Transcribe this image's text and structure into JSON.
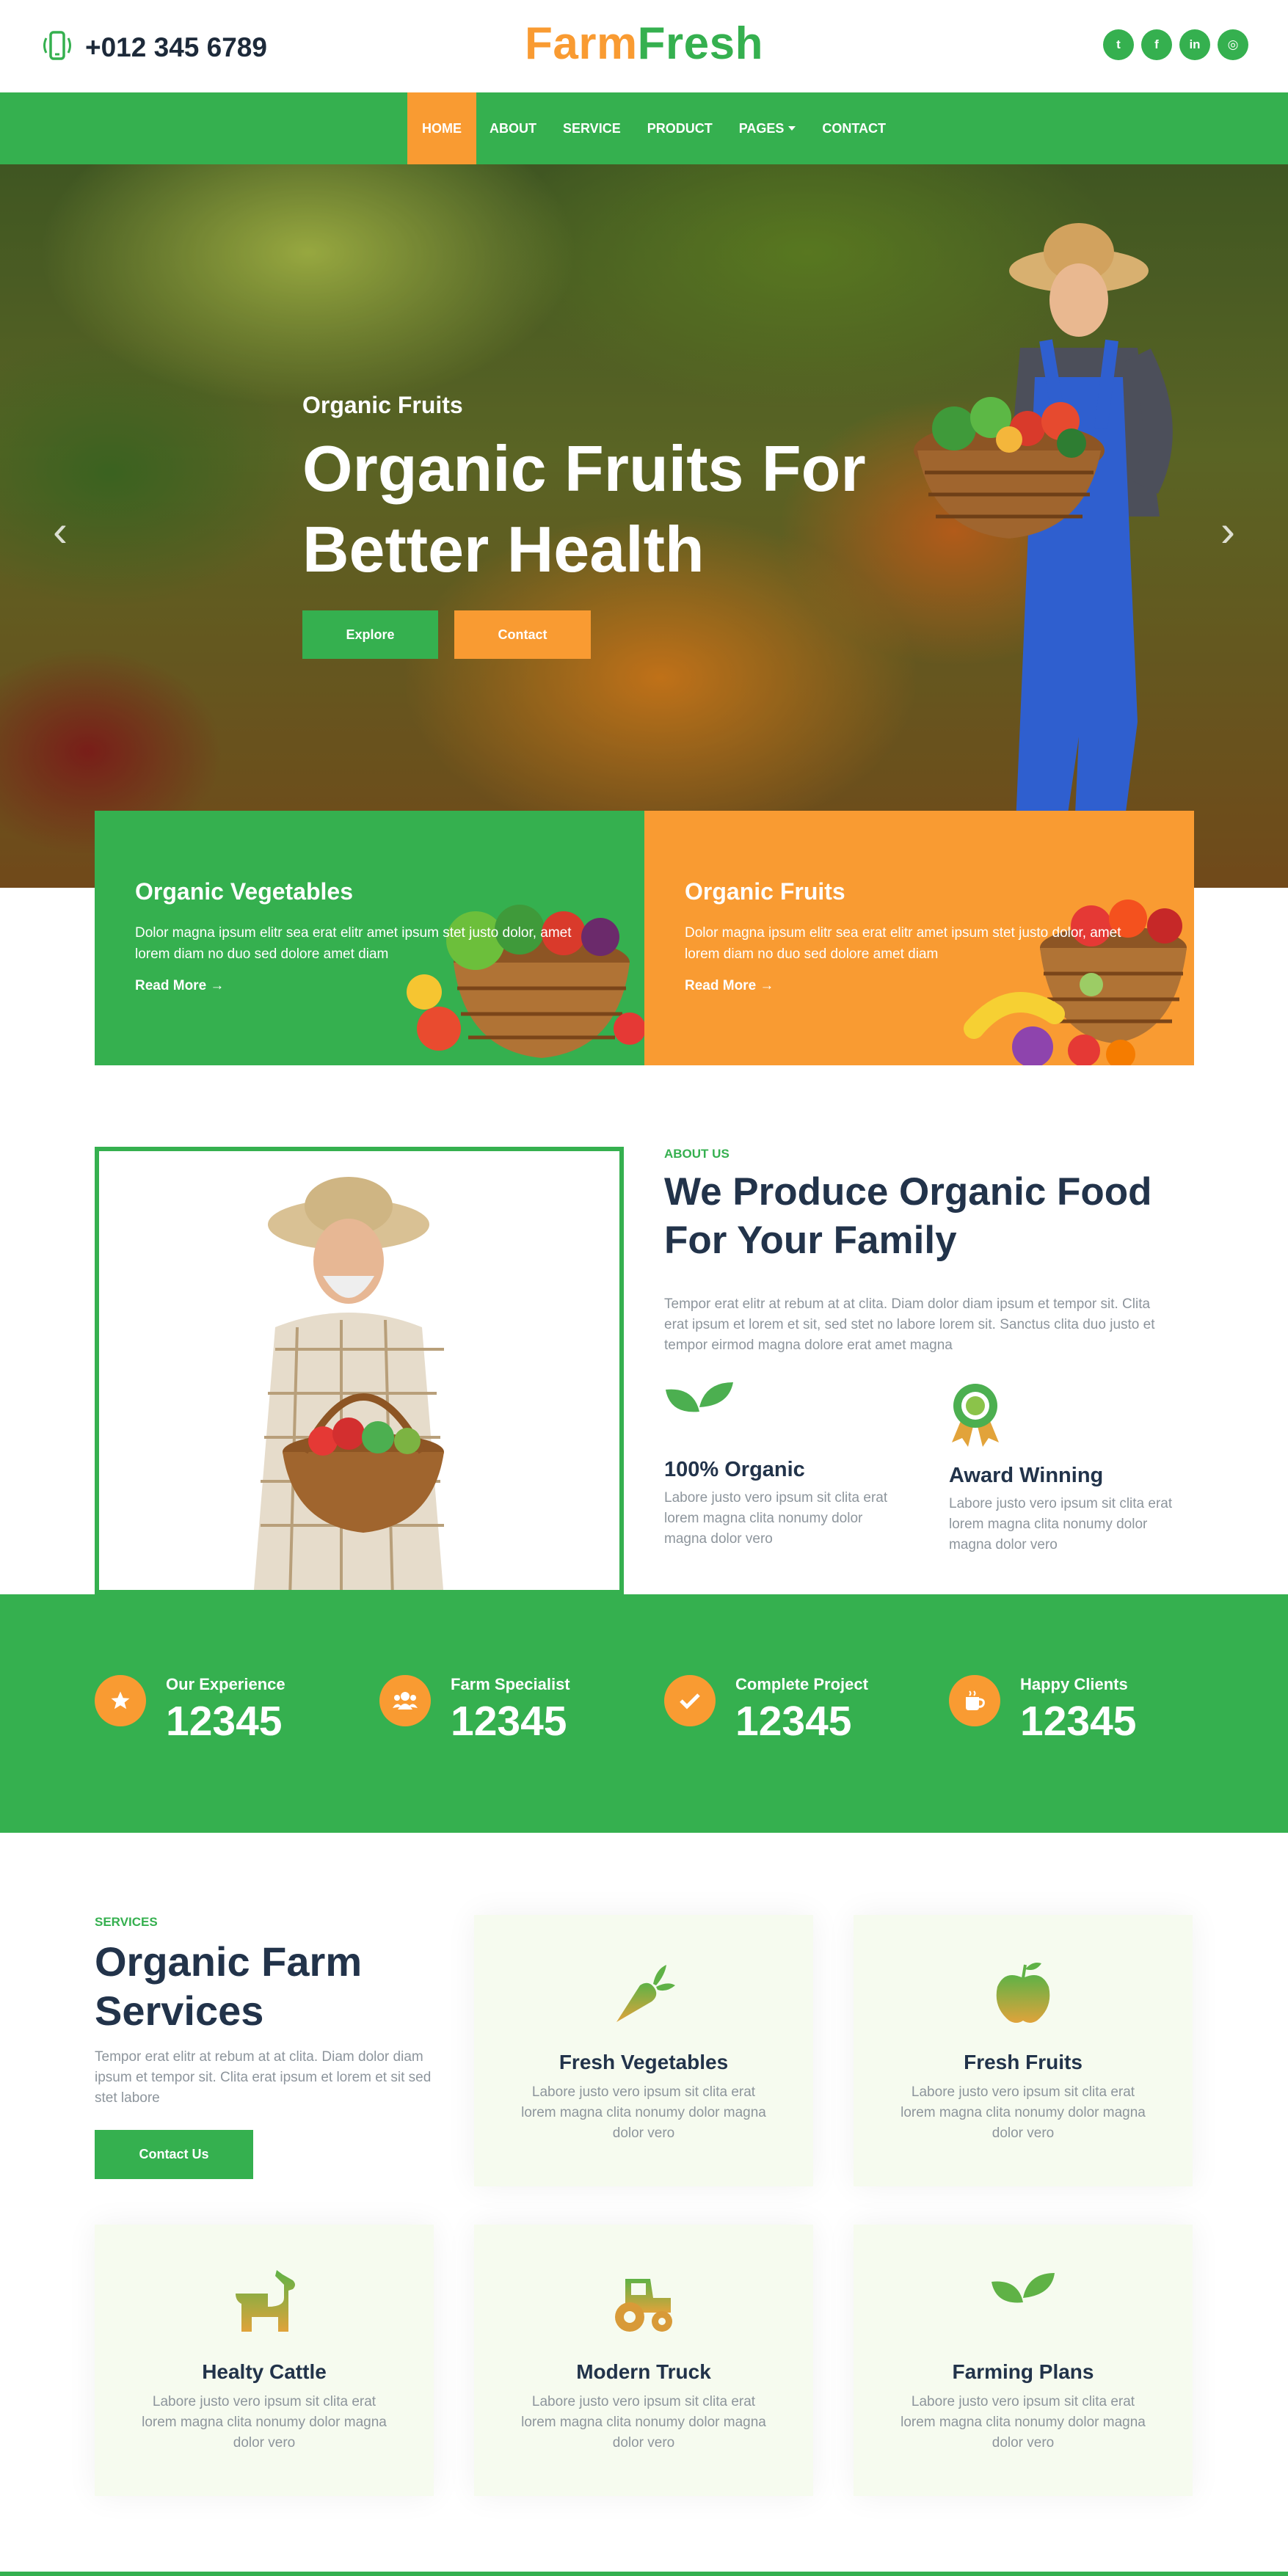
{
  "topbar": {
    "phone": "+012 345 6789",
    "logo_part1": "Farm",
    "logo_part2": "Fresh",
    "socials": [
      {
        "icon": "twitter-icon",
        "glyph": "t"
      },
      {
        "icon": "facebook-icon",
        "glyph": "f"
      },
      {
        "icon": "linkedin-icon",
        "glyph": "in"
      },
      {
        "icon": "instagram-icon",
        "glyph": "◎"
      }
    ]
  },
  "nav": {
    "items": [
      {
        "label": "HOME",
        "active": true
      },
      {
        "label": "ABOUT"
      },
      {
        "label": "SERVICE"
      },
      {
        "label": "PRODUCT"
      },
      {
        "label": "PAGES",
        "dropdown": true
      },
      {
        "label": "CONTACT"
      }
    ]
  },
  "hero": {
    "subtitle": "Organic Fruits",
    "title": "Organic Fruits For Better Health",
    "explore_label": "Explore",
    "contact_label": "Contact",
    "prev_arrow": "‹",
    "next_arrow": "›"
  },
  "promos": [
    {
      "title": "Organic Vegetables",
      "text": "Dolor magna ipsum elitr sea erat elitr amet ipsum stet justo dolor, amet lorem diam no duo sed dolore amet diam",
      "link": "Read More →"
    },
    {
      "title": "Organic Fruits",
      "text": "Dolor magna ipsum elitr sea erat elitr amet ipsum stet justo dolor, amet lorem diam no duo sed dolore amet diam",
      "link": "Read More →"
    }
  ],
  "about": {
    "label": "ABOUT US",
    "title": "We Produce Organic Food For Your Family",
    "text": "Tempor erat elitr at rebum at at clita. Diam dolor diam ipsum et tempor sit. Clita erat ipsum et lorem et sit, sed stet no labore lorem sit. Sanctus clita duo justo et tempor eirmod magna dolore erat amet magna",
    "features": [
      {
        "title": "100% Organic",
        "text": "Labore justo vero ipsum sit clita erat lorem magna clita nonumy dolor magna dolor vero",
        "icon": "sprout-icon"
      },
      {
        "title": "Award Winning",
        "text": "Labore justo vero ipsum sit clita erat lorem magna clita nonumy dolor magna dolor vero",
        "icon": "award-icon"
      }
    ]
  },
  "stats": [
    {
      "label": "Our Experience",
      "value": "12345",
      "icon": "star-icon"
    },
    {
      "label": "Farm Specialist",
      "value": "12345",
      "icon": "users-icon"
    },
    {
      "label": "Complete Project",
      "value": "12345",
      "icon": "check-icon"
    },
    {
      "label": "Happy Clients",
      "value": "12345",
      "icon": "mug-icon"
    }
  ],
  "services": {
    "label": "SERVICES",
    "title": "Organic Farm Services",
    "text": "Tempor erat elitr at rebum at at clita. Diam dolor diam ipsum et tempor sit. Clita erat ipsum et lorem et sit sed stet labore",
    "button_label": "Contact Us",
    "cards": [
      {
        "title": "Fresh Vegetables",
        "text": "Labore justo vero ipsum sit clita erat lorem magna clita nonumy dolor magna dolor vero",
        "icon": "carrot-icon"
      },
      {
        "title": "Fresh Fruits",
        "text": "Labore justo vero ipsum sit clita erat lorem magna clita nonumy dolor magna dolor vero",
        "icon": "apple-icon"
      },
      {
        "title": "Healty Cattle",
        "text": "Labore justo vero ipsum sit clita erat lorem magna clita nonumy dolor magna dolor vero",
        "icon": "dog-icon"
      },
      {
        "title": "Modern Truck",
        "text": "Labore justo vero ipsum sit clita erat lorem magna clita nonumy dolor magna dolor vero",
        "icon": "tractor-icon"
      },
      {
        "title": "Farming Plans",
        "text": "Labore justo vero ipsum sit clita erat lorem magna clita nonumy dolor magna dolor vero",
        "icon": "seedling-icon"
      }
    ]
  },
  "colors": {
    "green": "#35b04f",
    "orange": "#f99b32",
    "heading": "#22334a",
    "muted": "#8d959c"
  }
}
